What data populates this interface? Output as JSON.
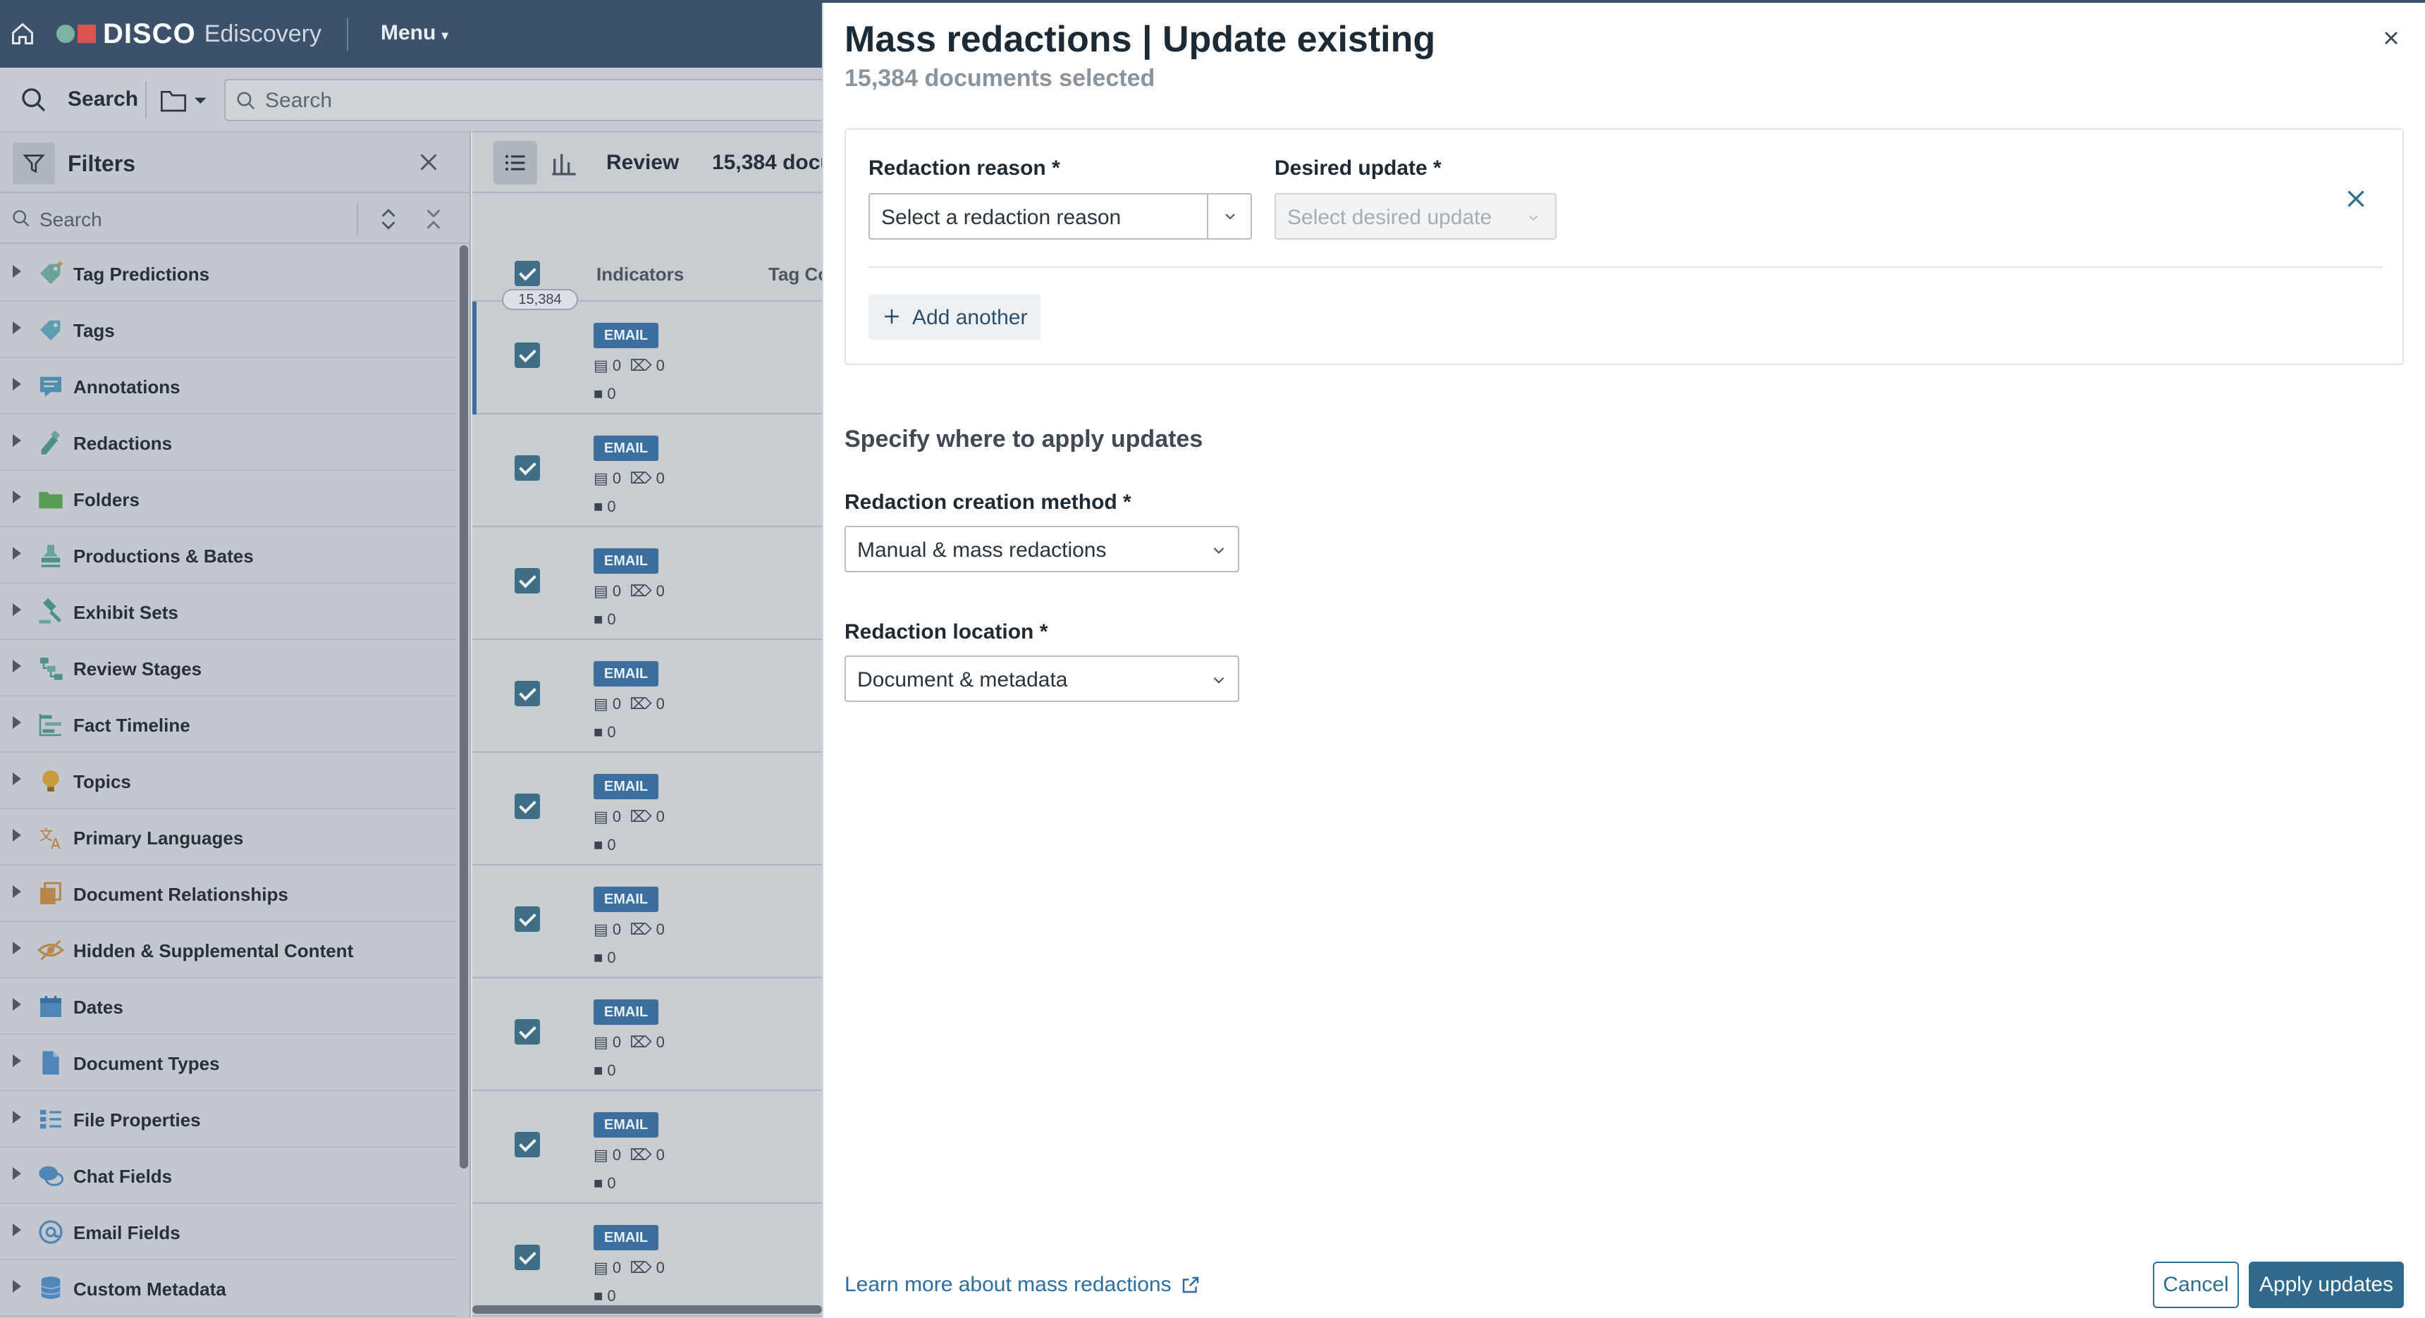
{
  "app": {
    "brand": "DISCO",
    "product": "Ediscovery",
    "menu_label": "Menu",
    "search_label": "Search",
    "search_placeholder": "Search"
  },
  "filters": {
    "title": "Filters",
    "search_placeholder": "Search",
    "items": [
      {
        "label": "Tag Predictions",
        "icon": "tag-prediction-icon"
      },
      {
        "label": "Tags",
        "icon": "tag-icon"
      },
      {
        "label": "Annotations",
        "icon": "annotation-icon"
      },
      {
        "label": "Redactions",
        "icon": "redaction-icon"
      },
      {
        "label": "Folders",
        "icon": "folder-icon"
      },
      {
        "label": "Productions & Bates",
        "icon": "stamp-icon"
      },
      {
        "label": "Exhibit Sets",
        "icon": "gavel-icon"
      },
      {
        "label": "Review Stages",
        "icon": "stages-icon"
      },
      {
        "label": "Fact Timeline",
        "icon": "timeline-icon"
      },
      {
        "label": "Topics",
        "icon": "lightbulb-icon"
      },
      {
        "label": "Primary Languages",
        "icon": "language-icon"
      },
      {
        "label": "Document Relationships",
        "icon": "relationship-icon"
      },
      {
        "label": "Hidden & Supplemental Content",
        "icon": "hidden-icon"
      },
      {
        "label": "Dates",
        "icon": "calendar-icon"
      },
      {
        "label": "Document Types",
        "icon": "document-icon"
      },
      {
        "label": "File Properties",
        "icon": "properties-icon"
      },
      {
        "label": "Chat Fields",
        "icon": "chat-icon"
      },
      {
        "label": "Email Fields",
        "icon": "at-icon"
      },
      {
        "label": "Custom Metadata",
        "icon": "database-icon"
      }
    ]
  },
  "docs": {
    "view_label": "Review",
    "count_label": "15,384 docu",
    "select_count": "15,384",
    "columns": {
      "indicators": "Indicators",
      "tag": "Tag Co"
    },
    "rows": [
      {
        "type": "EMAIL",
        "comments": "0",
        "attachments": "0",
        "folders": "0"
      },
      {
        "type": "EMAIL",
        "comments": "0",
        "attachments": "0",
        "folders": "0"
      },
      {
        "type": "EMAIL",
        "comments": "0",
        "attachments": "0",
        "folders": "0"
      },
      {
        "type": "EMAIL",
        "comments": "0",
        "attachments": "0",
        "folders": "0"
      },
      {
        "type": "EMAIL",
        "comments": "0",
        "attachments": "0",
        "folders": "0"
      },
      {
        "type": "EMAIL",
        "comments": "0",
        "attachments": "0",
        "folders": "0"
      },
      {
        "type": "EMAIL",
        "comments": "0",
        "attachments": "0",
        "folders": "0"
      },
      {
        "type": "EMAIL",
        "comments": "0",
        "attachments": "0",
        "folders": "0"
      },
      {
        "type": "EMAIL",
        "comments": "0",
        "attachments": "0",
        "folders": "0"
      }
    ]
  },
  "modal": {
    "title": "Mass redactions | Update existing",
    "subtitle": "15,384 documents selected",
    "reason_label": "Redaction reason *",
    "reason_placeholder": "Select a redaction reason",
    "update_label": "Desired update *",
    "update_placeholder": "Select desired update",
    "add_another": "Add another",
    "section_title": "Specify where to apply updates",
    "method_label": "Redaction creation method *",
    "method_value": "Manual & mass redactions",
    "location_label": "Redaction location *",
    "location_value": "Document & metadata",
    "learn_more": "Learn more about mass redactions",
    "cancel": "Cancel",
    "apply": "Apply updates"
  },
  "colors": {
    "topbar": "#3c526a",
    "primary": "#2f6a8d",
    "link": "#2d6ea0",
    "email_badge": "#3c6f9e"
  }
}
